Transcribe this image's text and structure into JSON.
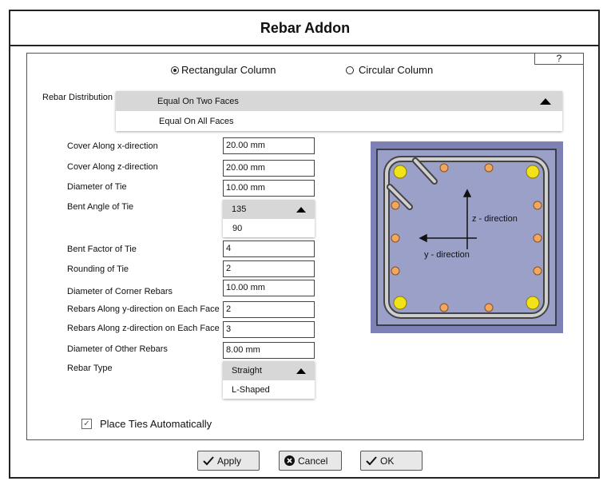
{
  "window": {
    "title": "Rebar Addon",
    "help_label": "?"
  },
  "column_type": {
    "rectangular": "Rectangular Column",
    "circular": "Circular Column",
    "selected": "rectangular"
  },
  "distribution": {
    "label": "Rebar Distribution",
    "selected": "Equal On Two Faces",
    "option": "Equal On All Faces"
  },
  "fields": {
    "cover_x": {
      "label": "Cover Along x-direction",
      "value": "20.00 mm"
    },
    "cover_z": {
      "label": "Cover Along z-direction",
      "value": "20.00 mm"
    },
    "tie_diameter": {
      "label": "Diameter of Tie",
      "value": "10.00 mm"
    },
    "bent_angle": {
      "label": "Bent Angle of Tie",
      "selected": "135",
      "option": "90"
    },
    "bent_factor": {
      "label": "Bent Factor of Tie",
      "value": "4"
    },
    "rounding": {
      "label": "Rounding of Tie",
      "value": "2"
    },
    "corner_diameter": {
      "label": "Diameter of Corner Rebars",
      "value": "10.00 mm"
    },
    "along_y": {
      "label": "Rebars Along y-direction on Each Face",
      "value": "2"
    },
    "along_z": {
      "label": "Rebars Along z-direction on Each Face",
      "value": "3"
    },
    "other_diameter": {
      "label": "Diameter of Other Rebars",
      "value": "8.00 mm"
    },
    "rebar_type": {
      "label": "Rebar Type",
      "selected": "Straight",
      "option": "L-Shaped"
    }
  },
  "diagram": {
    "z_label": "z - direction",
    "y_label": "y - direction"
  },
  "place_ties": {
    "label": "Place Ties Automatically",
    "checked": true
  },
  "buttons": {
    "apply": "Apply",
    "cancel": "Cancel",
    "ok": "OK"
  },
  "colors": {
    "dropdown_head": "#d7d7d7",
    "diagram_bg": "#7e81b6",
    "diagram_inner": "#9ba0c8",
    "corner_rebar": "#f2e21a",
    "other_rebar": "#f0a860"
  }
}
